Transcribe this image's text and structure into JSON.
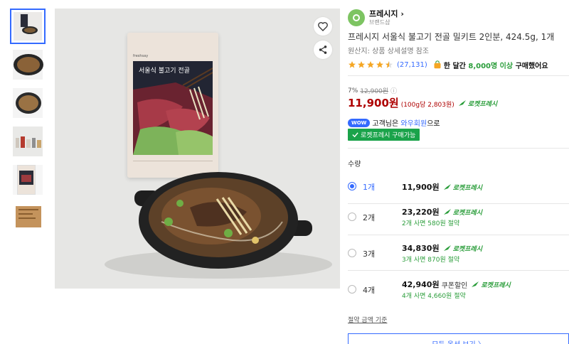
{
  "brand": {
    "name": "프레시지",
    "sub": "브랜드샵",
    "chevron": "›"
  },
  "product": {
    "title": "프레시지 서울식 불고기 전골 밀키트 2인분, 424.5g, 1개",
    "origin": "원산지: 상품 상세설명 참조",
    "package_brand": "freshsay",
    "package_title": "서울식 불고기 전골"
  },
  "rating": {
    "stars": 4.5,
    "reviews": "(27,131)"
  },
  "purchase_stat": {
    "prefix": "한 달간 ",
    "highlight": "8,000명 이상",
    "suffix": " 구매했어요"
  },
  "price": {
    "discount": "7%",
    "original": "12,900원",
    "info_icon": "ⓘ",
    "current": "11,900원",
    "unit": "(100g당 2,803원)",
    "rocket": "로켓프레시"
  },
  "wow": {
    "badge": "WOW",
    "prefix": "고객님은 ",
    "link": "와우회원",
    "suffix": "으로",
    "button": "로켓프레시 구매가능"
  },
  "quantity": {
    "label": "수량"
  },
  "options": [
    {
      "qty": "1개",
      "price": "11,900원",
      "rocket": "로켓프레시",
      "save": "",
      "coupon": "",
      "checked": true
    },
    {
      "qty": "2개",
      "price": "23,220원",
      "rocket": "로켓프레시",
      "save": "2개 사면 580원 절약",
      "coupon": "",
      "checked": false
    },
    {
      "qty": "3개",
      "price": "34,830원",
      "rocket": "로켓프레시",
      "save": "3개 사면 870원 절약",
      "coupon": "",
      "checked": false
    },
    {
      "qty": "4개",
      "price": "42,940원",
      "rocket": "로켓프레시",
      "save": "4개 사면 4,660원 절약",
      "coupon": "쿠폰할인",
      "checked": false
    }
  ],
  "criteria": "절약 금액 기준",
  "all_options": "모든 옵션 보기 〉",
  "colors": {
    "accent": "#346aff",
    "price_red": "#ae0000",
    "green": "#1aa34a",
    "star": "#f5a623"
  }
}
